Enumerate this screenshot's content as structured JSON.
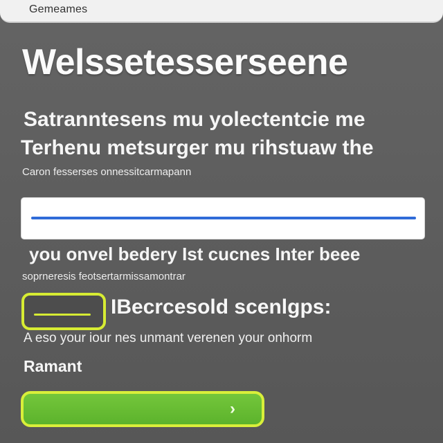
{
  "window": {
    "title": "Gemeames"
  },
  "main": {
    "heading": "Welssetesserseene",
    "line1": "Satranntesens mu yolectentcie me",
    "line2": "Terhenu metsurger mu rihstuaw the",
    "note1": "Caron fesserses onnessitcarmapann",
    "input": {
      "value": "",
      "placeholder": ""
    },
    "hint_large": "you onvel bedery Ist cucnes Inter beee",
    "hint_small": "soprneresis feotsertarmissamontrar",
    "toggle": {
      "label": "IBecrcesold scenlgps:",
      "description": "A eso your iour nes unmant verenen your onhorm",
      "checked": false
    },
    "section_label": "Ramant",
    "action_button": {
      "label": "",
      "icon": "chevron-down-icon"
    }
  },
  "colors": {
    "background": "#5f5f5f",
    "accent_blue": "#2f6bd8",
    "accent_yellow": "#d7ec33",
    "button_green": "#66bb33"
  }
}
